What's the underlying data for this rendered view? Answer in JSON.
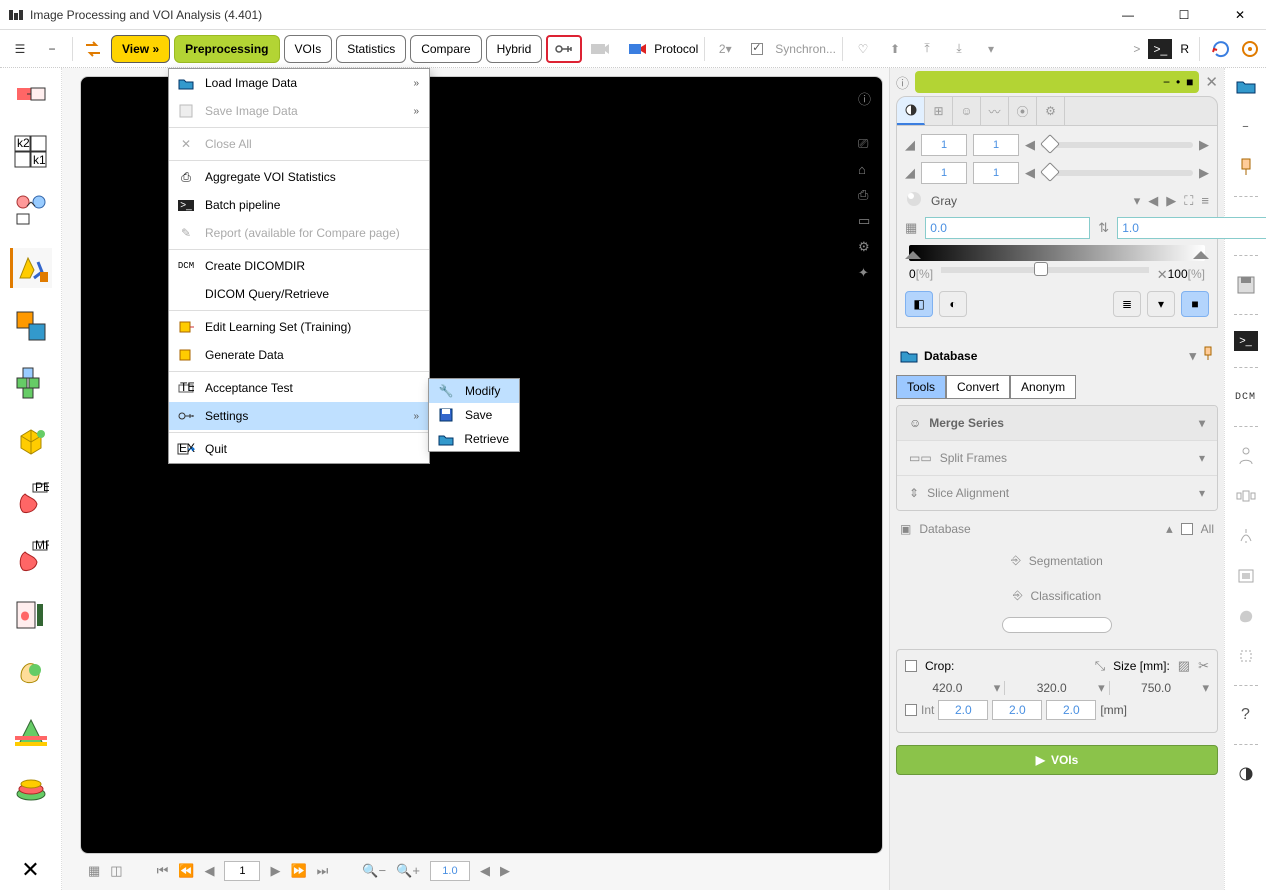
{
  "window": {
    "title": "Image Processing and VOI Analysis (4.401)"
  },
  "toolbar": {
    "tabs": {
      "view": "View »",
      "preprocessing": "Preprocessing",
      "vois": "VOIs",
      "statistics": "Statistics",
      "compare": "Compare",
      "hybrid": "Hybrid"
    },
    "protocol": "Protocol",
    "sync": "Synchron...",
    "two": "2",
    "r": "R",
    "chevron": ">"
  },
  "menu": {
    "load": "Load Image Data",
    "save": "Save Image Data",
    "closeall": "Close All",
    "aggvoi": "Aggregate VOI Statistics",
    "batch": "Batch pipeline",
    "report": "Report (available for Compare page)",
    "dicomdir": "Create DICOMDIR",
    "dicomdir_icon": "DCM",
    "dicomqr": "DICOM Query/Retrieve",
    "editlearn": "Edit Learning Set (Training)",
    "gendata": "Generate Data",
    "accept": "Acceptance Test",
    "settings": "Settings",
    "quit": "Quit"
  },
  "submenu": {
    "modify": "Modify",
    "save": "Save",
    "retrieve": "Retrieve"
  },
  "rightpanel": {
    "slider1_a": "1",
    "slider1_b": "1",
    "slider2_a": "1",
    "slider2_b": "1",
    "colormap": "Gray",
    "min": "0.0",
    "max": "1.0",
    "pct0": "0",
    "pct0_unit": "[%]",
    "pct100": "100",
    "pct100_unit": "[%]",
    "database": "Database",
    "tabs": {
      "tools": "Tools",
      "convert": "Convert",
      "anonym": "Anonym"
    },
    "merge": "Merge Series",
    "split": "Split Frames",
    "slice": "Slice Alignment",
    "dblabel": "Database",
    "all": "All",
    "seg": "Segmentation",
    "class": "Classification",
    "crop": "Crop:",
    "size": "Size [mm]:",
    "dims": {
      "x": "420.0",
      "y": "320.0",
      "z": "750.0",
      "default": "2.0",
      "mm": "[mm]"
    },
    "int": "Int",
    "voisbtn": "VOIs"
  },
  "rightsidebar": {
    "dcm": "DCM",
    "q": "?"
  },
  "canvas": {
    "page_input": "1",
    "zoom_input": "1.0"
  }
}
